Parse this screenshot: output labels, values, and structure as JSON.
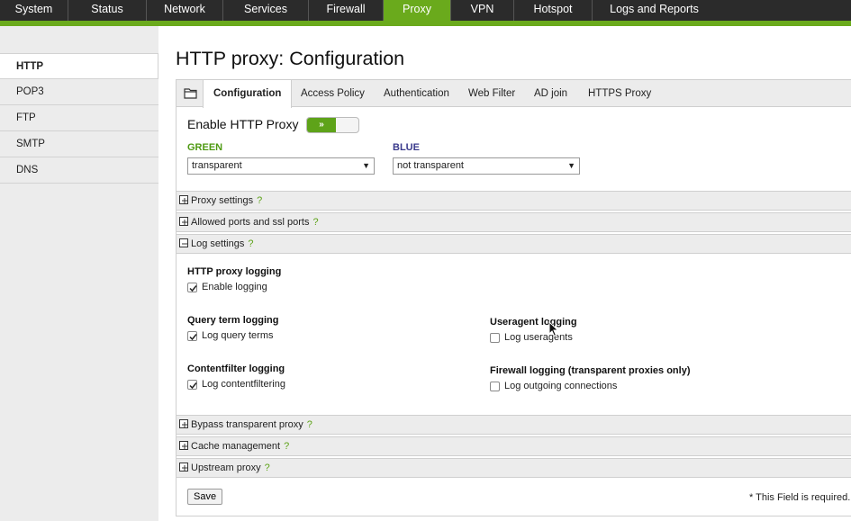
{
  "topnav": {
    "items": [
      {
        "label": "System"
      },
      {
        "label": "Status"
      },
      {
        "label": "Network"
      },
      {
        "label": "Services"
      },
      {
        "label": "Firewall"
      },
      {
        "label": "Proxy",
        "active": true
      },
      {
        "label": "VPN"
      },
      {
        "label": "Hotspot"
      },
      {
        "label": "Logs and Reports"
      }
    ]
  },
  "sidebar": {
    "items": [
      {
        "label": "HTTP",
        "active": true
      },
      {
        "label": "POP3"
      },
      {
        "label": "FTP"
      },
      {
        "label": "SMTP"
      },
      {
        "label": "DNS"
      }
    ]
  },
  "page": {
    "title": "HTTP proxy: Configuration"
  },
  "tabs": [
    {
      "label": "Configuration",
      "active": true
    },
    {
      "label": "Access Policy"
    },
    {
      "label": "Authentication"
    },
    {
      "label": "Web Filter"
    },
    {
      "label": "AD join"
    },
    {
      "label": "HTTPS Proxy"
    }
  ],
  "config": {
    "enable_label": "Enable HTTP Proxy",
    "toggle_symbol": "»",
    "toggle_on": true,
    "green_label": "GREEN",
    "green_value": "transparent",
    "blue_label": "BLUE",
    "blue_value": "not transparent"
  },
  "sections": {
    "proxy_settings": "Proxy settings",
    "allowed_ports": "Allowed ports and ssl ports",
    "log_settings": "Log settings",
    "bypass": "Bypass transparent proxy",
    "cache": "Cache management",
    "upstream": "Upstream proxy",
    "help_mark": "?"
  },
  "log": {
    "http_heading": "HTTP proxy logging",
    "enable_logging": "Enable logging",
    "query_heading": "Query term logging",
    "log_query_terms": "Log query terms",
    "useragent_heading": "Useragent logging",
    "log_useragents": "Log useragents",
    "contentfilter_heading": "Contentfilter logging",
    "log_contentfiltering": "Log contentfiltering",
    "firewall_heading": "Firewall logging (transparent proxies only)",
    "log_outgoing": "Log outgoing connections"
  },
  "footer": {
    "save_label": "Save",
    "required_note": "* This Field is required."
  },
  "colors": {
    "accent": "#6aaa1c",
    "nav_bg": "#2b2b2b",
    "green_zone": "#4e9a12",
    "blue_zone": "#3a3a8c"
  }
}
